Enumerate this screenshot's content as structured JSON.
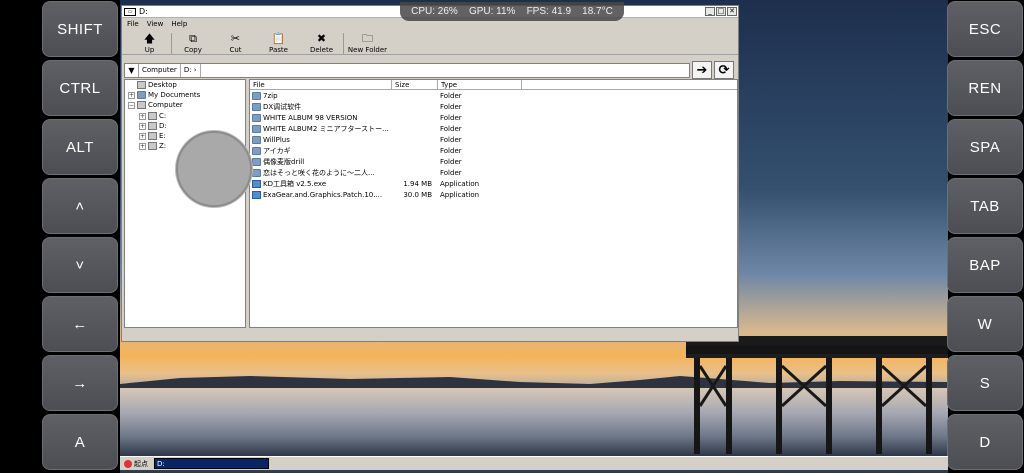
{
  "stats": {
    "cpu": "CPU: 26%",
    "gpu": "GPU: 11%",
    "fps": "FPS: 41.9",
    "temp": "18.7°C"
  },
  "left_buttons": [
    "SHIFT",
    "CTRL",
    "ALT",
    "˄",
    "˅",
    "←",
    "→",
    "A"
  ],
  "right_buttons": [
    "ESC",
    "REN",
    "SPA",
    "TAB",
    "BAP",
    "W",
    "S",
    "D"
  ],
  "window": {
    "title": "D:",
    "controls": {
      "minimize": "_",
      "maximize": "□",
      "close": "✕"
    },
    "menu": [
      "File",
      "View",
      "Help"
    ],
    "toolbar": [
      {
        "label": "Up",
        "icon": "arrow-up-icon",
        "glyph": "🡅"
      },
      {
        "label": "Copy",
        "icon": "copy-icon",
        "glyph": "⧉"
      },
      {
        "label": "Cut",
        "icon": "scissors-icon",
        "glyph": "✂"
      },
      {
        "label": "Paste",
        "icon": "paste-icon",
        "glyph": "📋"
      },
      {
        "label": "Delete",
        "icon": "delete-icon",
        "glyph": "✖"
      },
      {
        "label": "New Folder",
        "icon": "new-folder-icon",
        "glyph": "🗀"
      }
    ],
    "address": {
      "dropdown": "▼",
      "crumbs": [
        "Computer",
        "D:"
      ],
      "crumb_arrow": "›",
      "go": "➔",
      "refresh": "⟳"
    },
    "tree": {
      "desktop": "Desktop",
      "my_documents": "My Documents",
      "computer": "Computer",
      "drives": [
        "C:",
        "D:",
        "E:",
        "Z:"
      ]
    },
    "list": {
      "columns": [
        "File",
        "Size",
        "Type"
      ],
      "rows": [
        {
          "name": "7zip",
          "size": "",
          "type": "Folder"
        },
        {
          "name": "DX调试软件",
          "size": "",
          "type": "Folder"
        },
        {
          "name": "WHITE ALBUM 98 VERSION",
          "size": "",
          "type": "Folder"
        },
        {
          "name": "WHITE ALBUM2 ミニアフターストー...",
          "size": "",
          "type": "Folder"
        },
        {
          "name": "WillPlus",
          "size": "",
          "type": "Folder"
        },
        {
          "name": "アイカギ",
          "size": "",
          "type": "Folder"
        },
        {
          "name": "偶像麦版drill",
          "size": "",
          "type": "Folder"
        },
        {
          "name": "恋はそっと咲く花のように～二人...",
          "size": "",
          "type": "Folder"
        },
        {
          "name": "KD工具箱 v2.5.exe",
          "size": "1.94 MB",
          "type": "Application"
        },
        {
          "name": "ExaGear.and.Graphics.Patch.10....",
          "size": "30.0 MB",
          "type": "Application"
        }
      ]
    }
  },
  "taskbar": {
    "start": "起点",
    "task": "D:"
  },
  "colors": {
    "accent": "#0a246a",
    "folder": "#7e9cc4",
    "window_bg": "#d4d0c8"
  }
}
